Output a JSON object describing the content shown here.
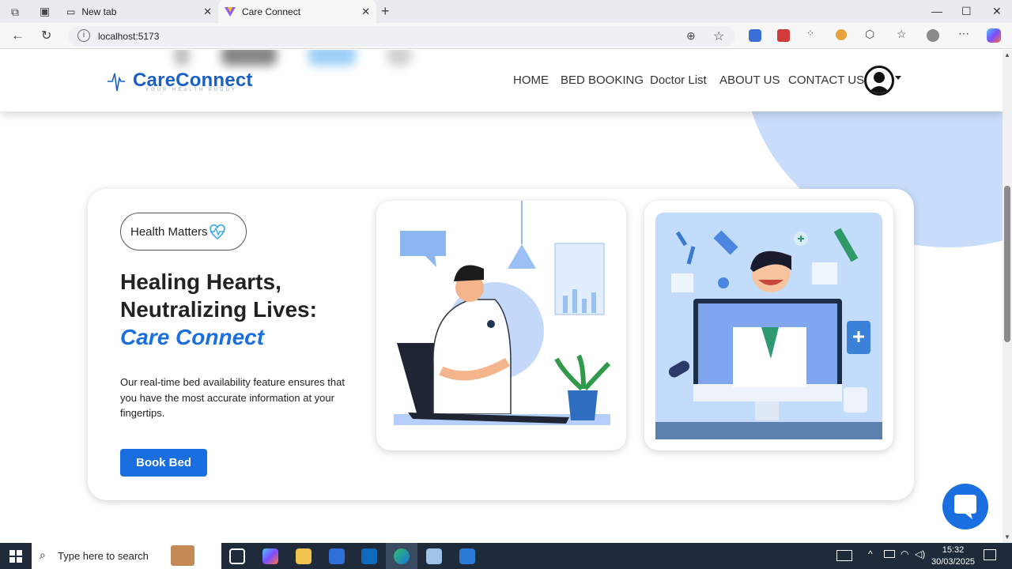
{
  "browser": {
    "tabs": [
      {
        "label": "New tab",
        "active": false
      },
      {
        "label": "Care Connect",
        "active": true
      }
    ],
    "url": "localhost:5173"
  },
  "header": {
    "brand": "CareConnect",
    "tagline": "YOUR HEALTH BUDDY",
    "nav": [
      "HOME",
      "BED BOOKING",
      "Doctor List",
      "ABOUT US",
      "CONTACT US"
    ]
  },
  "hero": {
    "badge": "Health Matters",
    "title_line1": "Healing Hearts,",
    "title_line2": "Neutralizing Lives:",
    "title_accent": "Care Connect",
    "description": "Our real-time bed availability feature ensures that you have the most accurate information at your fingertips.",
    "button": "Book Bed"
  },
  "taskbar": {
    "search_placeholder": "Type here to search",
    "time": "15:32",
    "date": "30/03/2025"
  },
  "colors": {
    "accent": "#1a6fe0",
    "brand": "#1a5fc8",
    "light_blue": "#c8ddfb",
    "taskbar": "#1f2a3a"
  }
}
